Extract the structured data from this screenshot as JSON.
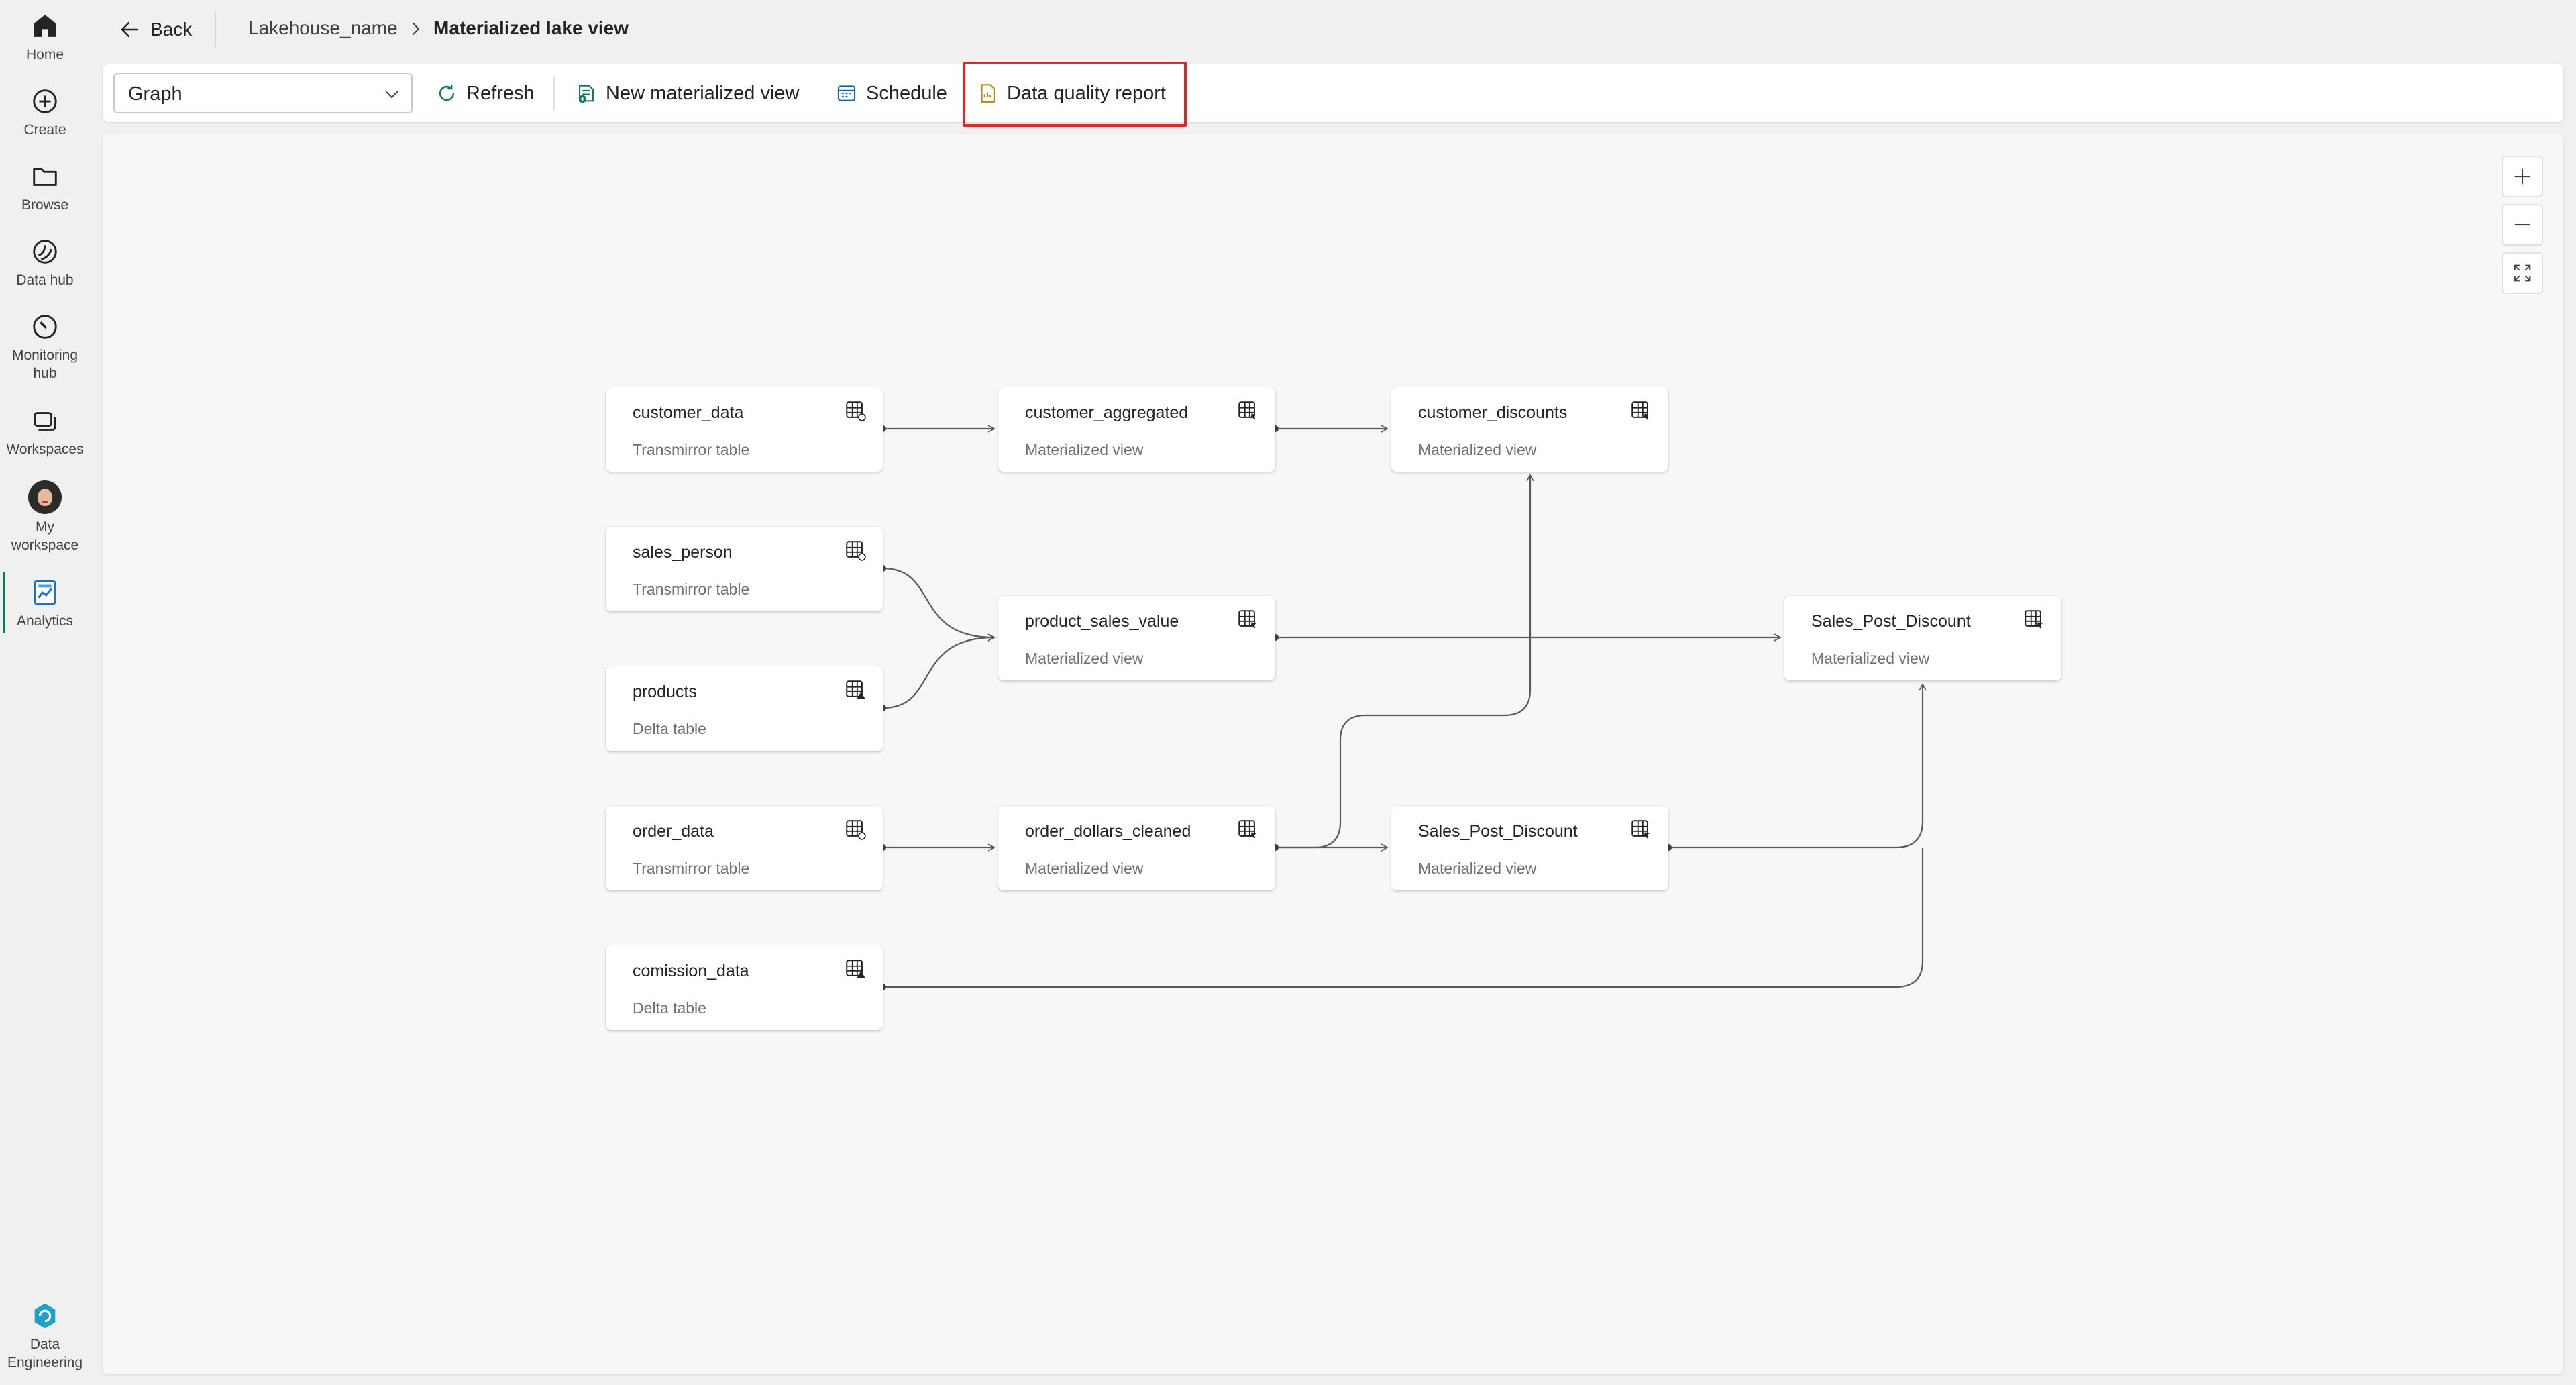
{
  "rail": {
    "items": [
      {
        "label": "Home",
        "icon": "home-icon"
      },
      {
        "label": "Create",
        "icon": "create-icon"
      },
      {
        "label": "Browse",
        "icon": "browse-icon"
      },
      {
        "label": "Data hub",
        "icon": "data-hub-icon"
      },
      {
        "label": "Monitoring\nhub",
        "icon": "monitoring-icon"
      },
      {
        "label": "Workspaces",
        "icon": "workspaces-icon"
      },
      {
        "label": "My\nworkspace",
        "icon": "avatar"
      },
      {
        "label": "Analytics",
        "icon": "analytics-icon"
      },
      {
        "label": "Data\nEngineering",
        "icon": "data-engineering-icon"
      }
    ],
    "active": "Analytics",
    "accent": "#117865"
  },
  "header": {
    "back_label": "Back",
    "breadcrumb": [
      "Lakehouse_name",
      "Materialized lake view"
    ]
  },
  "toolbar": {
    "view_select": "Graph",
    "refresh_label": "Refresh",
    "new_view_label": "New materialized view",
    "schedule_label": "Schedule",
    "dq_report_label": "Data quality report",
    "highlight_color": "#d42a31"
  },
  "graph": {
    "nodes": [
      {
        "id": "customer_data",
        "title": "customer_data",
        "type": "Transmirror table",
        "icon": "mirror-table-icon"
      },
      {
        "id": "customer_aggregated",
        "title": "customer_aggregated",
        "type": "Materialized view",
        "icon": "materialized-view-icon"
      },
      {
        "id": "customer_discounts",
        "title": "customer_discounts",
        "type": "Materialized view",
        "icon": "materialized-view-icon"
      },
      {
        "id": "sales_person",
        "title": "sales_person",
        "type": "Transmirror table",
        "icon": "mirror-table-icon"
      },
      {
        "id": "product_sales_value",
        "title": "product_sales_value",
        "type": "Materialized view",
        "icon": "materialized-view-icon"
      },
      {
        "id": "sales_post_discount_1",
        "title": "Sales_Post_Discount",
        "type": "Materialized view",
        "icon": "materialized-view-icon"
      },
      {
        "id": "products",
        "title": "products",
        "type": "Delta table",
        "icon": "delta-table-icon"
      },
      {
        "id": "order_data",
        "title": "order_data",
        "type": "Transmirror table",
        "icon": "mirror-table-icon"
      },
      {
        "id": "order_dollars_cleaned",
        "title": "order_dollars_cleaned",
        "type": "Materialized view",
        "icon": "materialized-view-icon"
      },
      {
        "id": "sales_post_discount_2",
        "title": "Sales_Post_Discount",
        "type": "Materialized view",
        "icon": "materialized-view-icon"
      },
      {
        "id": "comission_data",
        "title": "comission_data",
        "type": "Delta table",
        "icon": "delta-table-icon"
      }
    ],
    "edges": [
      [
        "customer_data",
        "customer_aggregated"
      ],
      [
        "customer_aggregated",
        "customer_discounts"
      ],
      [
        "sales_person",
        "product_sales_value"
      ],
      [
        "products",
        "product_sales_value"
      ],
      [
        "product_sales_value",
        "sales_post_discount_1"
      ],
      [
        "order_data",
        "order_dollars_cleaned"
      ],
      [
        "order_dollars_cleaned",
        "sales_post_discount_2"
      ],
      [
        "order_dollars_cleaned",
        "customer_discounts"
      ],
      [
        "sales_post_discount_2",
        "sales_post_discount_1"
      ],
      [
        "comission_data",
        "sales_post_discount_1"
      ]
    ]
  }
}
